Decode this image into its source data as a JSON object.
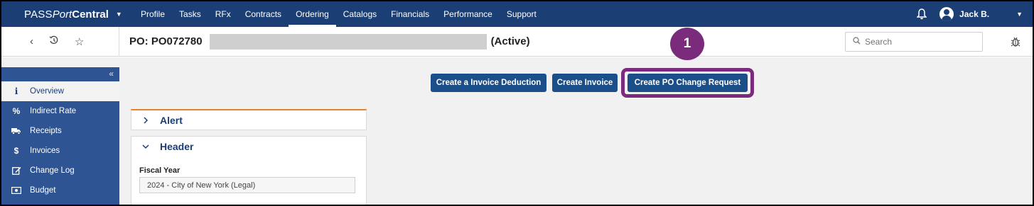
{
  "topnav": {
    "brand": {
      "part1": "PASS",
      "part2": "Port",
      "part3": "Central"
    },
    "menu": [
      {
        "label": "Profile"
      },
      {
        "label": "Tasks"
      },
      {
        "label": "RFx"
      },
      {
        "label": "Contracts"
      },
      {
        "label": "Ordering",
        "active": true
      },
      {
        "label": "Catalogs"
      },
      {
        "label": "Financials"
      },
      {
        "label": "Performance"
      },
      {
        "label": "Support"
      }
    ],
    "user_name": "Jack B."
  },
  "subbar": {
    "po_title": "PO: PO072780",
    "po_status": "(Active)",
    "search_placeholder": "Search"
  },
  "sidebar": {
    "items": [
      {
        "label": "Overview",
        "icon": "info-icon",
        "active": true
      },
      {
        "label": "Indirect Rate",
        "icon": "percent-icon"
      },
      {
        "label": "Receipts",
        "icon": "truck-icon"
      },
      {
        "label": "Invoices",
        "icon": "dollar-icon"
      },
      {
        "label": "Change Log",
        "icon": "edit-icon"
      },
      {
        "label": "Budget",
        "icon": "money-icon"
      }
    ]
  },
  "actions": {
    "invoice_deduction": "Create a Invoice Deduction",
    "invoice": "Create Invoice",
    "po_change_request": "Create PO Change Request"
  },
  "callout": {
    "number": "1",
    "color": "#7b2b7c"
  },
  "panels": {
    "alert_title": "Alert",
    "header_title": "Header",
    "fiscal_year_label": "Fiscal Year",
    "fiscal_year_value": "2024 - City of New York (Legal)"
  },
  "colors": {
    "nav_bg": "#1b3f74",
    "sidebar_bg": "#2f5494",
    "button_bg": "#1b4f8a",
    "alert_accent": "#e8822c"
  }
}
